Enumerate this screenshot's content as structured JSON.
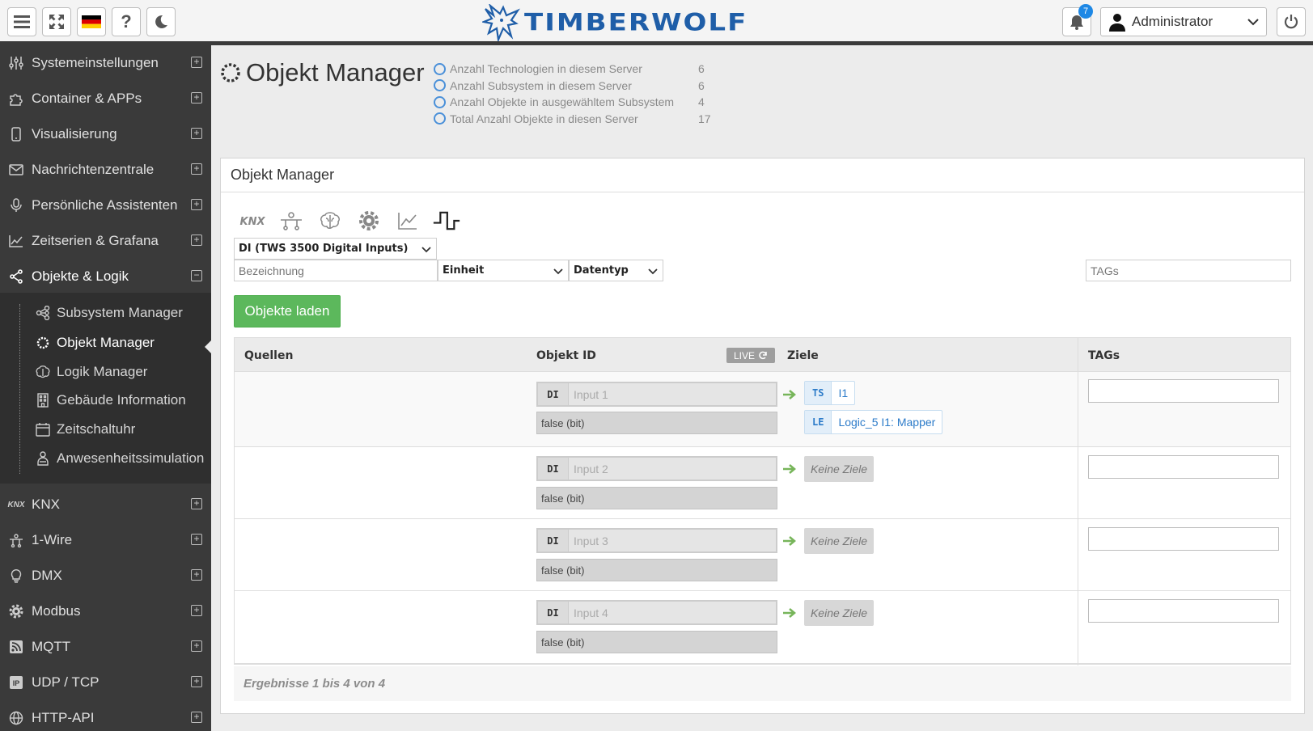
{
  "topbar": {
    "brand": "TIMBERWOLF",
    "notifications_count": "7",
    "user": "Administrator"
  },
  "sidebar": {
    "items": [
      {
        "label": "Systemeinstellungen",
        "icon": "sliders-icon"
      },
      {
        "label": "Container & APPs",
        "icon": "puzzle-icon"
      },
      {
        "label": "Visualisierung",
        "icon": "phone-icon"
      },
      {
        "label": "Nachrichtenzentrale",
        "icon": "envelope-icon"
      },
      {
        "label": "Persönliche Assistenten",
        "icon": "microphone-icon"
      },
      {
        "label": "Zeitserien & Grafana",
        "icon": "chart-icon"
      },
      {
        "label": "Objekte & Logik",
        "icon": "share-icon"
      }
    ],
    "subitems": [
      {
        "label": "Subsystem Manager",
        "icon": "sitemap-icon"
      },
      {
        "label": "Objekt Manager",
        "icon": "ring-icon"
      },
      {
        "label": "Logik Manager",
        "icon": "brain-icon"
      },
      {
        "label": "Gebäude Information",
        "icon": "building-icon"
      },
      {
        "label": "Zeitschaltuhr",
        "icon": "calendar-icon"
      },
      {
        "label": "Anwesenheitssimulation",
        "icon": "person-icon"
      }
    ],
    "items2": [
      {
        "label": "KNX",
        "icon": "knx-icon"
      },
      {
        "label": "1-Wire",
        "icon": "onewire-icon"
      },
      {
        "label": "DMX",
        "icon": "bulb-icon"
      },
      {
        "label": "Modbus",
        "icon": "cog-icon"
      },
      {
        "label": "MQTT",
        "icon": "rss-icon"
      },
      {
        "label": "UDP / TCP",
        "icon": "ip-icon"
      },
      {
        "label": "HTTP-API",
        "icon": "globe-icon"
      }
    ]
  },
  "header": {
    "title": "Objekt Manager",
    "stats": [
      {
        "label": "Anzahl Technologien in diesem Server",
        "value": "6"
      },
      {
        "label": "Anzahl Subsystem in diesem Server",
        "value": "6"
      },
      {
        "label": "Anzahl Objekte in ausgewähltem Subsystem",
        "value": "4"
      },
      {
        "label": "Total Anzahl Objekte in diesen Server",
        "value": "17"
      }
    ]
  },
  "panel": {
    "title": "Objekt Manager",
    "subsystem_select": "DI (TWS 3500 Digital Inputs)",
    "bezeichnung_placeholder": "Bezeichnung",
    "einheit": "Einheit",
    "datentyp": "Datentyp",
    "tags_placeholder": "TAGs",
    "load_button": "Objekte laden"
  },
  "table": {
    "columns": [
      "Quellen",
      "Objekt ID",
      "Ziele",
      "TAGs"
    ],
    "live_label": "LIVE",
    "rows": [
      {
        "type": "DI",
        "name": "Input 1",
        "value": "false (bit)",
        "targets": [
          {
            "type": "TS",
            "name": "I1"
          },
          {
            "type": "LE",
            "name": "Logic_5 I1: Mapper"
          }
        ]
      },
      {
        "type": "DI",
        "name": "Input 2",
        "value": "false (bit)",
        "no_targets": "Keine Ziele"
      },
      {
        "type": "DI",
        "name": "Input 3",
        "value": "false (bit)",
        "no_targets": "Keine Ziele"
      },
      {
        "type": "DI",
        "name": "Input 4",
        "value": "false (bit)",
        "no_targets": "Keine Ziele"
      }
    ],
    "footer": "Ergebnisse 1 bis 4 von 4"
  }
}
